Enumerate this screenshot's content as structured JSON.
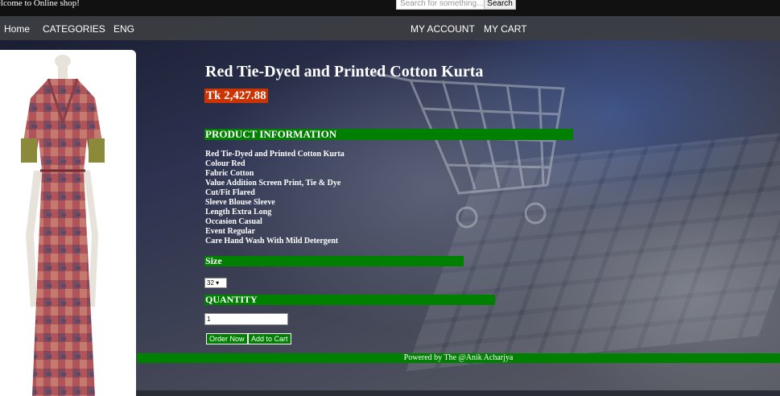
{
  "header": {
    "welcome": "elcome to Online shop!",
    "search_placeholder": "Search for something...",
    "search_button": "Search"
  },
  "nav": {
    "home": "Home",
    "categories": "CATEGORIES",
    "language": "ENG",
    "account": "MY ACCOUNT",
    "cart": "MY CART"
  },
  "product": {
    "title": "Red Tie-Dyed and Printed Cotton Kurta",
    "price": "Tk 2,427.88",
    "info_heading": "PRODUCT INFORMATION",
    "details": [
      "Red Tie-Dyed and Printed Cotton Kurta",
      "Colour Red",
      "Fabric Cotton",
      "Value Addition Screen Print, Tie & Dye",
      "Cut/Fit Flared",
      "Sleeve Blouse Sleeve",
      "Length Extra Long",
      "Occasion Casual",
      "Event Regular",
      "Care Hand Wash With Mild Detergent"
    ],
    "size_heading": "Size",
    "size_selected": "32 ▾",
    "quantity_heading": "QUANTITY",
    "quantity_value": "1",
    "order_button": "Order Now",
    "cart_button": "Add to Cart"
  },
  "footer": {
    "text": "Powered by The @Anik Acharjya"
  },
  "colors": {
    "accent_green": "#008000",
    "price_bg": "#cc3300"
  }
}
